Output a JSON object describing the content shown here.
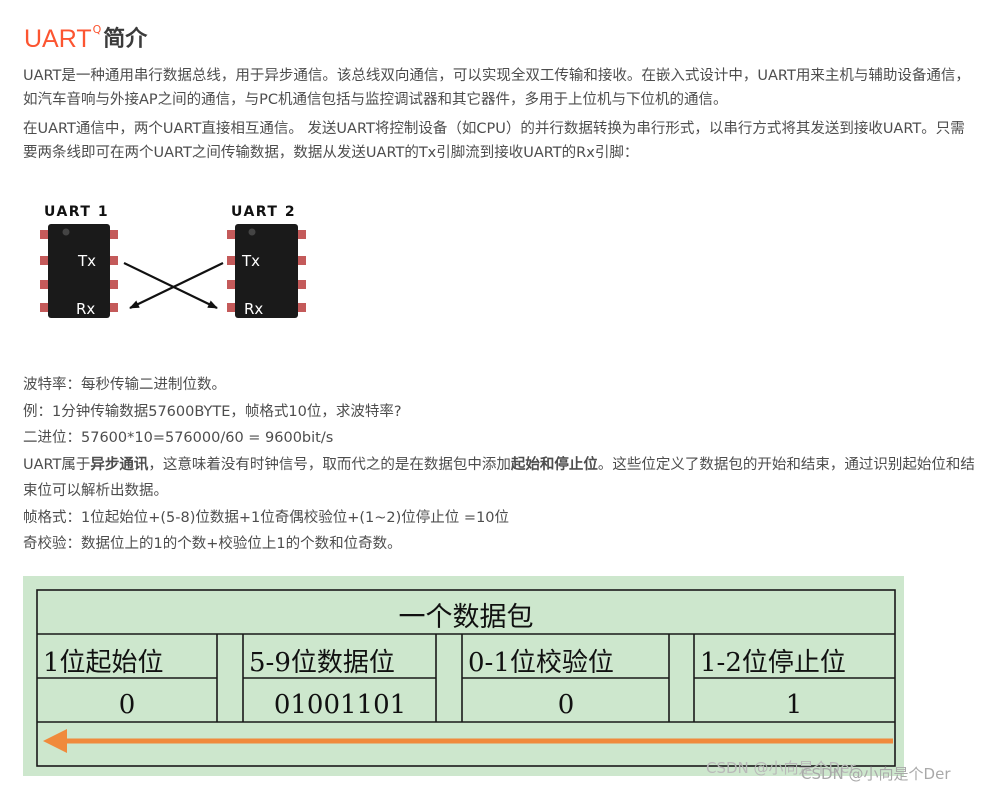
{
  "header": {
    "title_latin": "UART",
    "title_cjk": "简介",
    "title_mark": "Q"
  },
  "intro": {
    "p1": "UART是一种通用串行数据总线，用于异步通信。该总线双向通信，可以实现全双工传输和接收。在嵌入式设计中，UART用来主机与辅助设备通信，如汽车音响与外接AP之间的通信，与PC机通信包括与监控调试器和其它器件，多用于上位机与下位机的通信。",
    "p2": "在UART通信中，两个UART直接相互通信。 发送UART将控制设备（如CPU）的并行数据转换为串行形式，以串行方式将其发送到接收UART。只需要两条线即可在两个UART之间传输数据，数据从发送UART的Tx引脚流到接收UART的Rx引脚："
  },
  "figure": {
    "chip1_label": "UART 1",
    "chip2_label": "UART 2",
    "tx": "Tx",
    "rx": "Rx"
  },
  "details": {
    "baud": "波特率：每秒传输二进制位数。",
    "example": "例：1分钟传输数据57600BYTE，帧格式10位，求波特率?",
    "binary": "二进位：57600*10=576000/60 = 9600bit/s",
    "async_pre": "UART属于",
    "async_bold": "异步通讯",
    "async_mid": "，这意味着没有时钟信号，取而代之的是在数据包中添加",
    "async_bold2": "起始和停止位",
    "async_post": "。这些位定义了数据包的开始和结束，通过识别起始位和结束位可以解析出数据。",
    "frame": "帧格式：1位起始位+(5-8)位数据+1位奇偶校验位+(1~2)位停止位 =10位",
    "parity": "奇校验：数据位上的1的个数+校验位上1的个数和位奇数。"
  },
  "packet": {
    "title": "一个数据包",
    "headers": [
      "1位起始位",
      "5-9位数据位",
      "0-1位校验位",
      "1-2位停止位"
    ],
    "values": [
      "0",
      "01001101",
      "0",
      "1"
    ]
  },
  "watermark": {
    "text1": "CSDN @小向是个Der",
    "text2": "CSDN @小向是个Der"
  },
  "colors": {
    "accent": "#fc5531",
    "packet_bg": "#cde7cd",
    "arrow": "#f08a3c"
  }
}
